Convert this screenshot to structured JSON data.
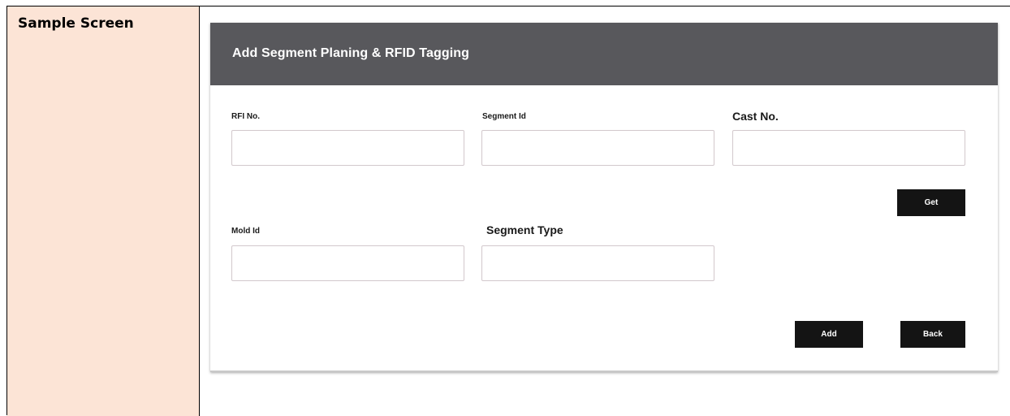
{
  "section_label": "Sample Screen",
  "screen": {
    "title": "Add  Segment Planing & RFID Tagging",
    "fields": {
      "rfi_no": {
        "label": "RFI No.",
        "value": "",
        "placeholder": ""
      },
      "segment_id": {
        "label": "Segment  Id",
        "value": "",
        "placeholder": ""
      },
      "cast_no": {
        "label": "Cast No.",
        "value": "",
        "placeholder": ""
      },
      "mold_id": {
        "label": "Mold Id",
        "value": "",
        "placeholder": ""
      },
      "segment_type": {
        "label": "Segment Type",
        "value": "",
        "placeholder": ""
      }
    },
    "buttons": {
      "get": "Get",
      "add": "Add",
      "back": "Back"
    }
  },
  "colors": {
    "label_cell_bg": "#fce4d6",
    "header_bg": "#58585c",
    "button_bg": "#141414"
  }
}
